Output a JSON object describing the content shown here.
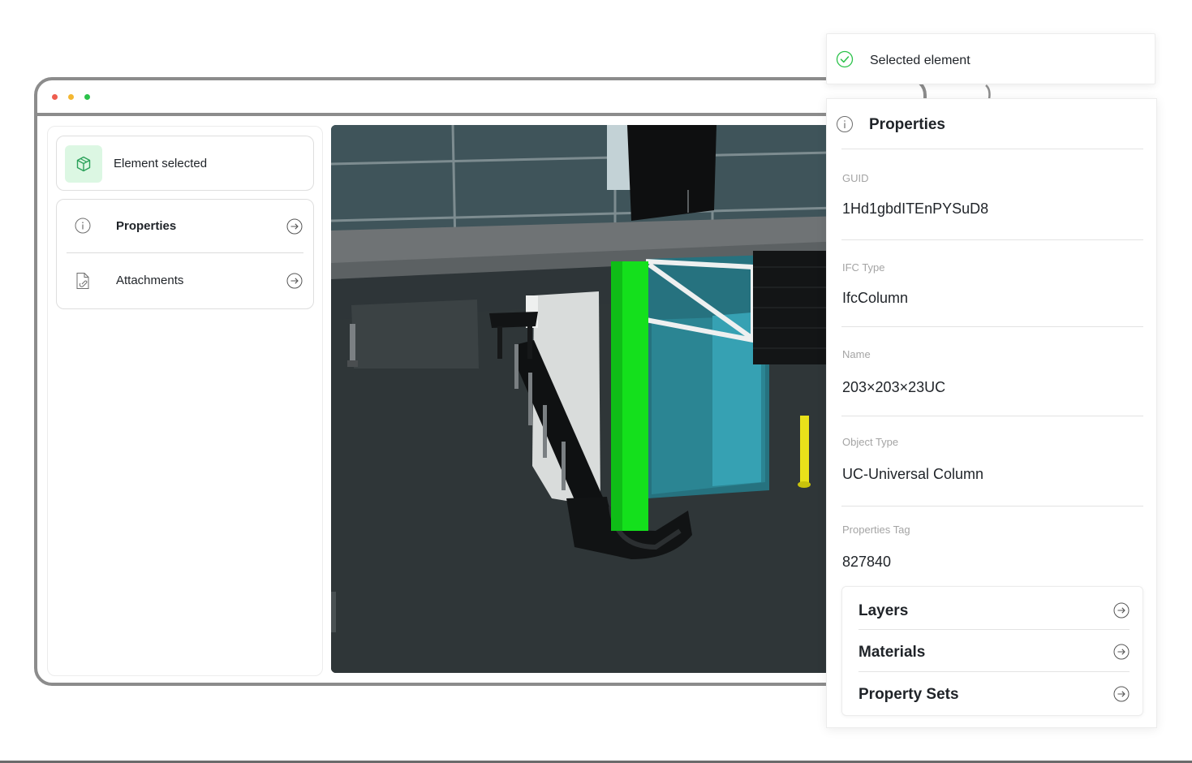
{
  "window": {
    "selected_card": {
      "label": "Element selected",
      "icon": "cube-icon"
    },
    "menu": [
      {
        "label": "Properties",
        "icon": "info-icon"
      },
      {
        "label": "Attachments",
        "icon": "document-icon"
      }
    ]
  },
  "toast": {
    "label": "Selected element",
    "icon": "check-circle-icon"
  },
  "properties": {
    "title": "Properties",
    "fields": [
      {
        "label": "GUID",
        "value": "1Hd1gbdITEnPYSuD8"
      },
      {
        "label": "IFC Type",
        "value": "IfcColumn"
      },
      {
        "label": "Name",
        "value": "203×203×23UC"
      },
      {
        "label": "Object Type",
        "value": "UC-Universal Column"
      },
      {
        "label": "Properties Tag",
        "value": "827840"
      }
    ],
    "links": [
      {
        "label": "Layers"
      },
      {
        "label": "Materials"
      },
      {
        "label": "Property Sets"
      }
    ]
  },
  "colors": {
    "accent_green": "#2bc24a",
    "selected_element": "#14e01c",
    "window_border": "#8c8c8c"
  }
}
